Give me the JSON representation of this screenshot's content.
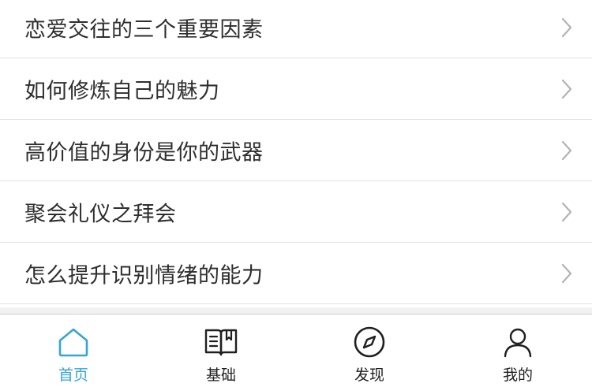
{
  "list": {
    "items": [
      {
        "label": "恋爱交往的三个重要因素"
      },
      {
        "label": "如何修炼自己的魅力"
      },
      {
        "label": "高价值的身份是你的武器"
      },
      {
        "label": "聚会礼仪之拜会"
      },
      {
        "label": "怎么提升识别情绪的能力"
      }
    ]
  },
  "tabbar": {
    "tabs": [
      {
        "label": "首页",
        "icon": "home-icon",
        "active": true
      },
      {
        "label": "基础",
        "icon": "book-icon",
        "active": false
      },
      {
        "label": "发现",
        "icon": "compass-icon",
        "active": false
      },
      {
        "label": "我的",
        "icon": "user-icon",
        "active": false
      }
    ]
  },
  "colors": {
    "accent": "#35a4d6",
    "text": "#2e2e2e",
    "divider": "#e2e2e2",
    "chevron": "#b3b3b3"
  }
}
